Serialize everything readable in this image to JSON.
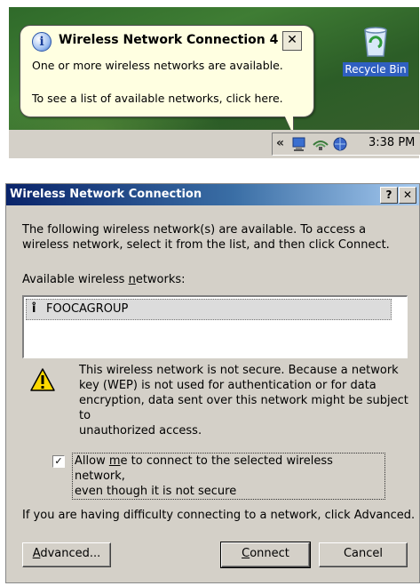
{
  "balloon": {
    "title": "Wireless Network Connection 4",
    "close_symbol": "✕",
    "line1": "One or more wireless networks are available.",
    "line2": "To see a list of available networks, click here.",
    "info_icon": "info-icon"
  },
  "desktop": {
    "recycle_bin_label": "Recycle Bin"
  },
  "taskbar": {
    "chevron": "«",
    "clock": "3:38 PM"
  },
  "dialog": {
    "title": "Wireless Network Connection",
    "help_symbol": "?",
    "close_symbol": "✕",
    "intro_line1": "The following wireless network(s) are available. To access a",
    "intro_line2": "wireless network, select it from the list, and then click Connect.",
    "available_label_pre": "Available wireless ",
    "available_label_accel": "n",
    "available_label_post": "etworks:",
    "networks": [
      {
        "name": "FOOCAGROUP",
        "icon": "antenna-icon"
      }
    ],
    "warning_lines": [
      "This wireless network is not secure. Because a network",
      "key (WEP) is not used for authentication or for data",
      "encryption, data sent over this network might be subject to",
      "unauthorized access."
    ],
    "allow_checked": true,
    "allow_label_pre": "Allow ",
    "allow_label_accel": "m",
    "allow_label_post": "e to connect to the selected wireless network,",
    "allow_label_line2": "even though it is not secure",
    "advanced_hint": "If you are having difficulty connecting to a network, click Advanced.",
    "buttons": {
      "advanced_accel": "A",
      "advanced_rest": "dvanced...",
      "connect_accel": "C",
      "connect_rest": "onnect",
      "cancel": "Cancel"
    }
  }
}
